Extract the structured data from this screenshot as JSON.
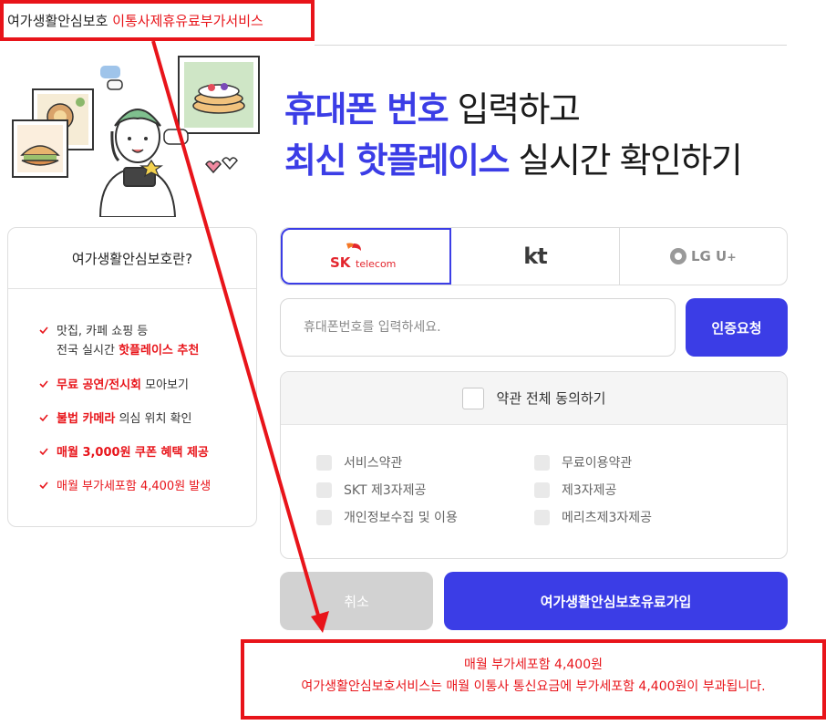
{
  "header": {
    "label_plain": "여가생활안심보호",
    "label_red": "이통사제휴유료부가서비스"
  },
  "headline": {
    "line1_accent": "휴대폰 번호",
    "line1_rest": " 입력하고",
    "line2_accent": "최신 핫플레이스",
    "line2_rest": " 실시간 확인하기"
  },
  "info": {
    "title": "여가생활안심보호란?",
    "items": [
      {
        "line1": "맛집, 카페 쇼핑 등",
        "line2_plain": "전국 실시간 ",
        "line2_hl": "핫플레이스 추천"
      },
      {
        "hl": "무료 공연/전시회",
        "plain": " 모아보기"
      },
      {
        "hl": "불법 카메라",
        "plain": " 의심 위치 확인"
      },
      {
        "hl": "매월 3,000원 쿠폰 혜택 제공"
      },
      {
        "note": "매월 부가세포함 4,400원 발생"
      }
    ]
  },
  "carriers": {
    "skt_sk": "SK",
    "skt_telecom": "telecom",
    "kt": "kt",
    "lgu": "LG U",
    "lgu_plus": "+"
  },
  "phone": {
    "placeholder": "휴대폰번호를 입력하세요.",
    "verify_label": "인증요청"
  },
  "terms": {
    "all_label": "약관 전체 동의하기",
    "items": [
      "서비스약관",
      "무료이용약관",
      "SKT 제3자제공",
      "제3자제공",
      "개인정보수집 및 이용",
      "메리츠제3자제공"
    ]
  },
  "buttons": {
    "cancel": "취소",
    "join": "여가생활안심보호유료가입"
  },
  "notice": {
    "line1": "매월 부가세포함 4,400원",
    "line2": "여가생활안심보호서비스는 매월 이통사 통신요금에 부가세포함 4,400원이 부과됩니다."
  },
  "colors": {
    "accent": "#3b3de6",
    "alert": "#e8141a",
    "sk_red": "#e3262e",
    "sk_orange": "#f47725"
  }
}
